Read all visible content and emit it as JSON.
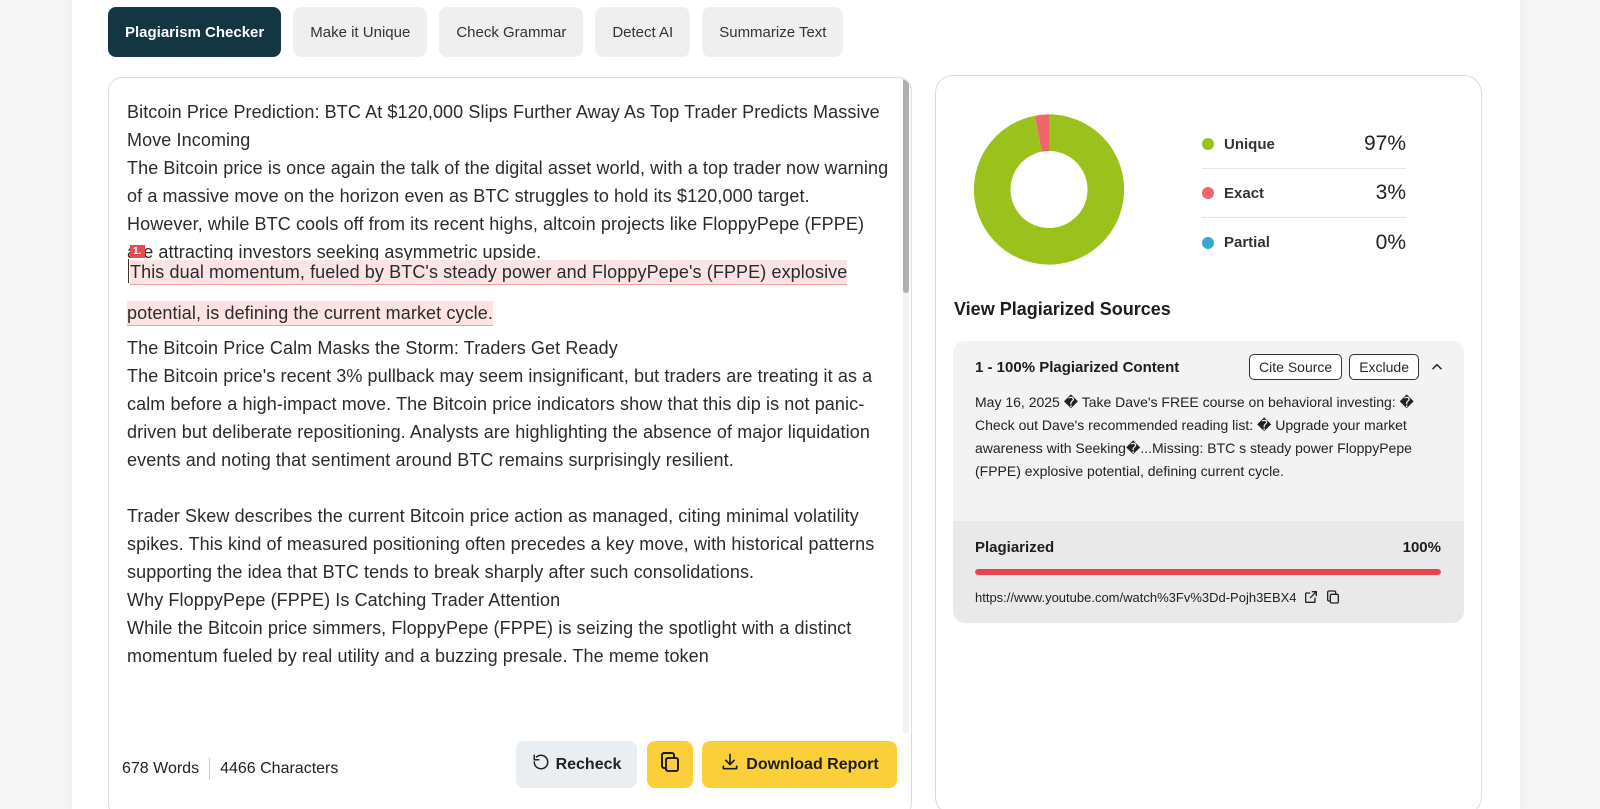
{
  "tabs": [
    {
      "label": "Plagiarism Checker",
      "active": true
    },
    {
      "label": "Make it Unique",
      "active": false
    },
    {
      "label": "Check Grammar",
      "active": false
    },
    {
      "label": "Detect AI",
      "active": false
    },
    {
      "label": "Summarize Text",
      "active": false
    }
  ],
  "editor": {
    "title_line": "Bitcoin Price Prediction: BTC At $120,000 Slips Further Away As Top Trader Predicts Massive Move Incoming",
    "para1_plain": "The Bitcoin price is once again the talk of the digital asset world, with a top trader now warning of a massive move on the horizon even as BTC struggles to hold its $120,000 target. However, while BTC cools off from its recent highs, altcoin projects like FloppyPepe (FPPE) are attracting investors seeking asymmetric upside. ",
    "para1_highlight": "This dual momentum, fueled by BTC's steady power and FloppyPepe's (FPPE) explosive potential, is defining the current market cycle.",
    "highlight_marker": "1.",
    "heading2": "The Bitcoin Price Calm Masks the Storm: Traders Get Ready",
    "para2": "The Bitcoin price's recent 3% pullback may seem insignificant, but traders are treating it as a calm before a high-impact move. The Bitcoin price indicators show that this dip is not panic-driven but deliberate repositioning. Analysts are highlighting the absence of major liquidation events and noting that sentiment around BTC remains surprisingly resilient.",
    "para3": "Trader Skew describes the current Bitcoin price action as managed, citing minimal volatility spikes. This kind of measured positioning often precedes a key move, with historical patterns supporting the idea that BTC tends to break sharply after such consolidations.",
    "heading3": "Why FloppyPepe (FPPE) Is Catching Trader Attention",
    "para4": "While the Bitcoin price simmers, FloppyPepe (FPPE) is seizing the spotlight with a distinct momentum fueled by real utility and a buzzing presale. The meme token"
  },
  "footer": {
    "words": "678 Words",
    "characters": "4466 Characters",
    "recheck_label": "Recheck",
    "download_label": "Download Report"
  },
  "stats": {
    "donut_colors": {
      "unique": "#9bc21c",
      "exact": "#f0646c",
      "partial": "#3aa9d0"
    },
    "legend": [
      {
        "label": "Unique",
        "value": "97%",
        "fraction": 0.97,
        "color": "#9bc21c"
      },
      {
        "label": "Exact",
        "value": "3%",
        "fraction": 0.03,
        "color": "#f0646c"
      },
      {
        "label": "Partial",
        "value": "0%",
        "fraction": 0.0,
        "color": "#3aa9d0"
      }
    ]
  },
  "sources": {
    "title": "View Plagiarized Sources",
    "items": [
      {
        "header": "1 - 100% Plagiarized Content",
        "cite_label": "Cite Source",
        "exclude_label": "Exclude",
        "text": "May 16, 2025 � Take Dave's FREE course on behavioral investing: � Check out Dave's recommended reading list: � Upgrade your market awareness with Seeking�...Missing: BTC s steady power FloppyPepe (FPPE) explosive potential, defining current cycle.",
        "plag_label": "Plagiarized",
        "plag_value": "100%",
        "plag_fraction": 1.0,
        "url": "https://www.youtube.com/watch%3Fv%3Dd-Pojh3EBX4"
      }
    ]
  }
}
